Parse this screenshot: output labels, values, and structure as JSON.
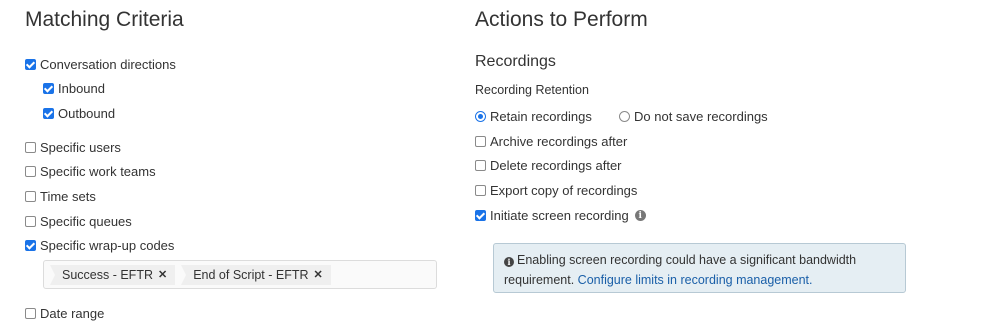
{
  "matching": {
    "title": "Matching Criteria",
    "conversation_directions": {
      "label": "Conversation directions",
      "checked": true
    },
    "inbound": {
      "label": "Inbound",
      "checked": true
    },
    "outbound": {
      "label": "Outbound",
      "checked": true
    },
    "specific_users": {
      "label": "Specific users",
      "checked": false
    },
    "specific_work_teams": {
      "label": "Specific work teams",
      "checked": false
    },
    "time_sets": {
      "label": "Time sets",
      "checked": false
    },
    "specific_queues": {
      "label": "Specific queues",
      "checked": false
    },
    "specific_wrapup_codes": {
      "label": "Specific wrap-up codes",
      "checked": true
    },
    "wrapup_tags": [
      "Success - EFTR",
      "End of Script - EFTR"
    ],
    "date_range": {
      "label": "Date range",
      "checked": false
    }
  },
  "actions": {
    "title": "Actions to Perform",
    "section": "Recordings",
    "retention_label": "Recording Retention",
    "retain": {
      "label": "Retain recordings",
      "selected": true
    },
    "do_not_save": {
      "label": "Do not save recordings",
      "selected": false
    },
    "archive": {
      "label": "Archive recordings after",
      "checked": false
    },
    "delete": {
      "label": "Delete recordings after",
      "checked": false
    },
    "export": {
      "label": "Export copy of recordings",
      "checked": false
    },
    "screen": {
      "label": "Initiate screen recording",
      "checked": true
    },
    "alert_text": "Enabling screen recording could have a significant bandwidth requirement.",
    "alert_link": "Configure limits in recording management."
  },
  "icons": {
    "tag_remove": "close-icon",
    "info": "info-icon"
  },
  "colors": {
    "accent": "#1a73e8",
    "link": "#1a5fa8",
    "alert_bg": "#e5eef3"
  }
}
